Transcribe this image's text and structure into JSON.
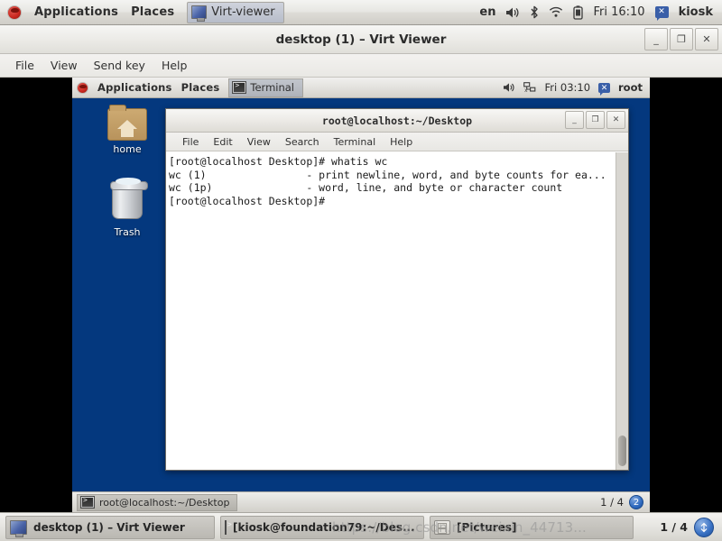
{
  "host_panel": {
    "menus": [
      {
        "label": "Applications",
        "icon": "redhat-icon"
      },
      {
        "label": "Places",
        "icon": ""
      }
    ],
    "window_button": {
      "label": "Virt-viewer",
      "icon": "monitor-icon"
    },
    "tray": {
      "keyboard_layout": "en",
      "icons": [
        "volume-icon",
        "bluetooth-icon",
        "wifi-icon",
        "battery-icon"
      ],
      "clock": "Fri 16:10",
      "user": "kiosk",
      "user_icon": "user-status-icon"
    }
  },
  "virt_viewer": {
    "title": "desktop (1) – Virt Viewer",
    "window_controls": {
      "minimize": "_",
      "maximize": "❐",
      "close": "✕"
    },
    "menus": [
      "File",
      "View",
      "Send key",
      "Help"
    ]
  },
  "guest": {
    "panel": {
      "menus": [
        {
          "label": "Applications",
          "icon": "redhat-icon"
        },
        {
          "label": "Places",
          "icon": ""
        }
      ],
      "window_button": {
        "label": "Terminal",
        "icon": "terminal-icon"
      },
      "tray": {
        "icons": [
          "volume-icon",
          "network-disconnected-icon"
        ],
        "clock": "Fri 03:10",
        "user": "root",
        "user_icon": "user-status-icon"
      }
    },
    "desktop_icons": [
      {
        "label": "home",
        "icon": "home-folder-icon"
      },
      {
        "label": "Trash",
        "icon": "trash-icon"
      }
    ],
    "taskbar": {
      "buttons": [
        {
          "label": "root@localhost:~/Desktop",
          "icon": "terminal-icon"
        }
      ],
      "workspace": "1 / 4",
      "workspace_badge": "2"
    }
  },
  "terminal": {
    "title": "root@localhost:~/Desktop",
    "window_controls": {
      "minimize": "_",
      "maximize": "❐",
      "close": "✕"
    },
    "menus": [
      "File",
      "Edit",
      "View",
      "Search",
      "Terminal",
      "Help"
    ],
    "lines": [
      "[root@localhost Desktop]# whatis wc",
      "wc (1)                - print newline, word, and byte counts for ea...",
      "wc (1p)               - word, line, and byte or character count",
      "[root@localhost Desktop]#"
    ]
  },
  "host_taskbar": {
    "buttons": [
      {
        "label": "desktop (1) – Virt Viewer",
        "icon": "monitor-icon"
      },
      {
        "label": "[kiosk@foundation79:~/Des...",
        "icon": "terminal-icon"
      },
      {
        "label": "[Pictures]",
        "icon": "file-manager-icon"
      }
    ],
    "workspace": "1 / 4",
    "workspace_badge": ""
  },
  "watermark": {
    "text": "https://blog.csdn.net/weixin_44713..."
  },
  "colors": {
    "desktop_blue": "#04387e",
    "panel_grey": "#e3e2de",
    "accent_blue": "#2f6ac0"
  }
}
